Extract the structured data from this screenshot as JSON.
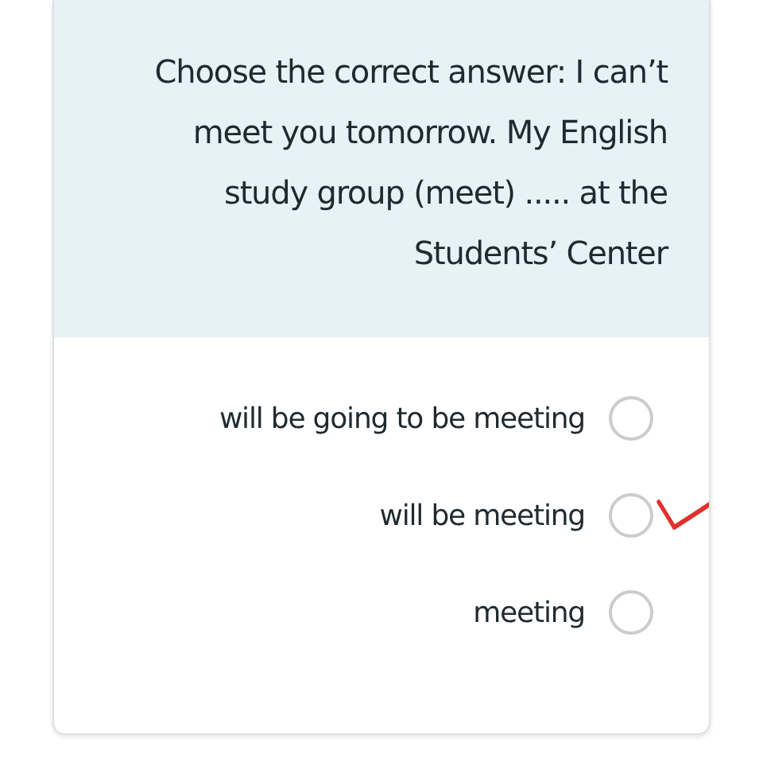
{
  "question": "Choose the correct answer: I can’t meet you tomorrow. My English study group (meet) ..... at the Students’ Center",
  "options": [
    {
      "label": "will be going to be meeting",
      "selected": false,
      "marked": false
    },
    {
      "label": "will be meeting",
      "selected": false,
      "marked": true
    },
    {
      "label": "meeting",
      "selected": false,
      "marked": false
    }
  ]
}
